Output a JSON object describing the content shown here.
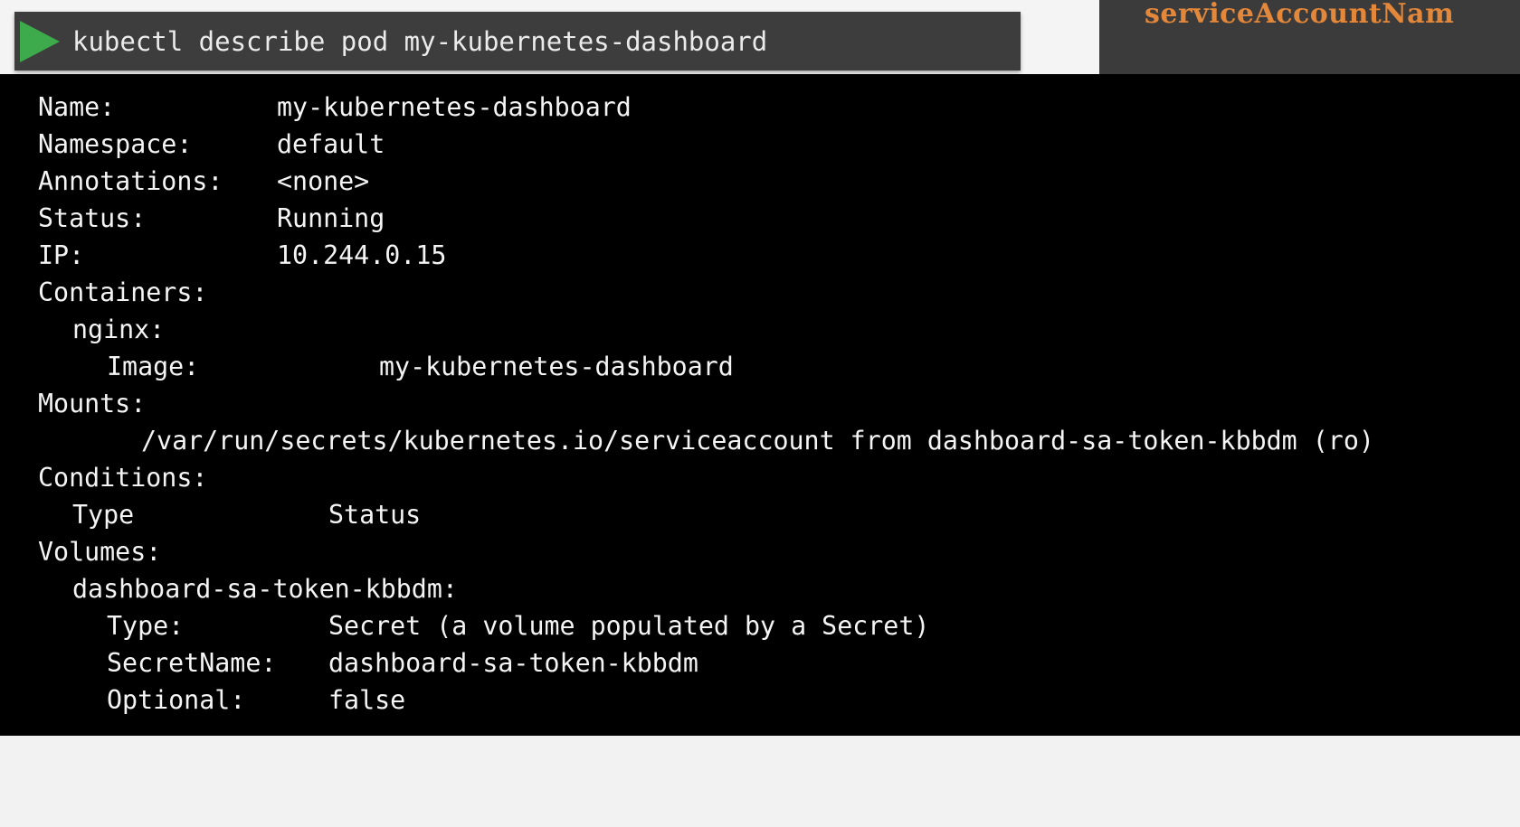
{
  "header": {
    "command": "kubectl describe pod my-kubernetes-dashboard",
    "side_label": "serviceAccountNam",
    "side_label_color": "#e3873a",
    "run_icon": "play-icon",
    "run_icon_color": "#3dab4b"
  },
  "output": {
    "name": {
      "key": "Name:",
      "value": "my-kubernetes-dashboard"
    },
    "namespace": {
      "key": "Namespace:",
      "value": "default"
    },
    "annotations": {
      "key": "Annotations:",
      "value": "<none>"
    },
    "status": {
      "key": "Status:",
      "value": "Running"
    },
    "ip": {
      "key": "IP:",
      "value": "10.244.0.15"
    },
    "containers": {
      "key": "Containers:"
    },
    "container_nginx": {
      "key": "nginx:"
    },
    "image": {
      "key": "Image:",
      "value": "my-kubernetes-dashboard"
    },
    "mounts": {
      "key": "Mounts:"
    },
    "mount_path": {
      "value": "/var/run/secrets/kubernetes.io/serviceaccount from dashboard-sa-token-kbbdm (ro)"
    },
    "conditions": {
      "key": "Conditions:"
    },
    "conditions_header": {
      "key": "Type",
      "value": "Status"
    },
    "volumes": {
      "key": "Volumes:"
    },
    "volume_name": {
      "key": "dashboard-sa-token-kbbdm:"
    },
    "volume_type": {
      "key": "Type:",
      "value": "Secret (a volume populated by a Secret)"
    },
    "secret_name": {
      "key": "SecretName:",
      "value": "dashboard-sa-token-kbbdm"
    },
    "optional": {
      "key": "Optional:",
      "value": "false"
    }
  }
}
